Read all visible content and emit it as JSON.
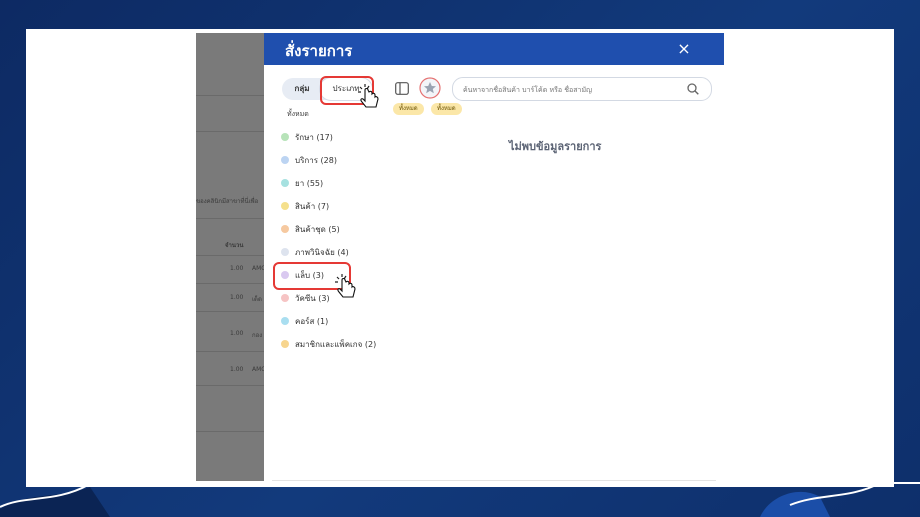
{
  "modal": {
    "title": "สั่งรายการ",
    "close_label": "×"
  },
  "tabs": {
    "group_label": "กลุ่ม",
    "type_label": "ประเภท"
  },
  "search": {
    "placeholder": "ค้นหาจากชื่อสินค้า บาร์โค้ด หรือ ชื่อสามัญ"
  },
  "chips": [
    "ทั้งหมด",
    "ทั้งหมด"
  ],
  "all_label": "ทั้งหมด",
  "categories": [
    {
      "label": "รักษา (17)",
      "color": "#b7e3b9"
    },
    {
      "label": "บริการ (28)",
      "color": "#bcd4f2"
    },
    {
      "label": "ยา (55)",
      "color": "#a6e1e0"
    },
    {
      "label": "สินค้า (7)",
      "color": "#f5e08c"
    },
    {
      "label": "สินค้าชุด (5)",
      "color": "#f6c9a0"
    },
    {
      "label": "ภาพวินิจฉัย (4)",
      "color": "#dde3ee"
    },
    {
      "label": "แล็บ (3)",
      "color": "#d9c9f0"
    },
    {
      "label": "วัคซีน (3)",
      "color": "#f6c4c4"
    },
    {
      "label": "คอร์ส (1)",
      "color": "#a9def0"
    },
    {
      "label": "สมาชิกและแพ็คเกจ (2)",
      "color": "#f7d58e"
    }
  ],
  "empty_message": "ไม่พบข้อมูลรายการ",
  "background_table": {
    "side_text": "ของคลินิกมีสาขาที่นี่เพื่อ",
    "qty_header": "จำนวน",
    "rows": [
      {
        "qty": "1.00",
        "name": "AMO"
      },
      {
        "qty": "1.00",
        "name": "เด็ด"
      },
      {
        "qty": "1.00",
        "name": "กอง"
      },
      {
        "qty": "1.00",
        "name": "AMO"
      }
    ]
  },
  "colors": {
    "header": "#1f4fae",
    "highlight": "#e53935",
    "chip": "#fbe7a8"
  }
}
